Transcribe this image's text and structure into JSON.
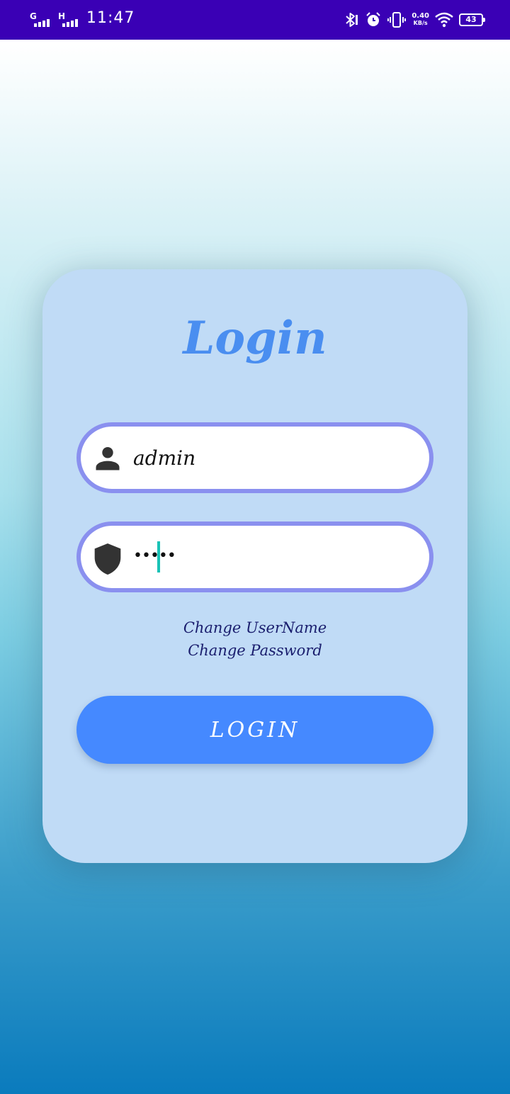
{
  "status_bar": {
    "sim1_type": "G",
    "sim2_type": "H",
    "time": "11:47",
    "net_speed_value": "0.40",
    "net_speed_unit": "KB/s",
    "battery_level": "43",
    "icons": [
      "bluetooth-icon",
      "alarm-icon",
      "vibrate-icon",
      "wifi-icon",
      "battery-icon"
    ]
  },
  "login": {
    "title": "Login",
    "username_value": "admin",
    "password_masked": "•••••",
    "change_username_label": "Change UserName",
    "change_password_label": "Change Password",
    "login_button_label": "LOGIN"
  },
  "colors": {
    "status_bar": "#3a00b5",
    "card_background": "#c0dbf6",
    "accent": "#4589ff",
    "field_border": "#8a90ef",
    "link_text": "#1a1e6e",
    "caret": "#19c2b6"
  }
}
